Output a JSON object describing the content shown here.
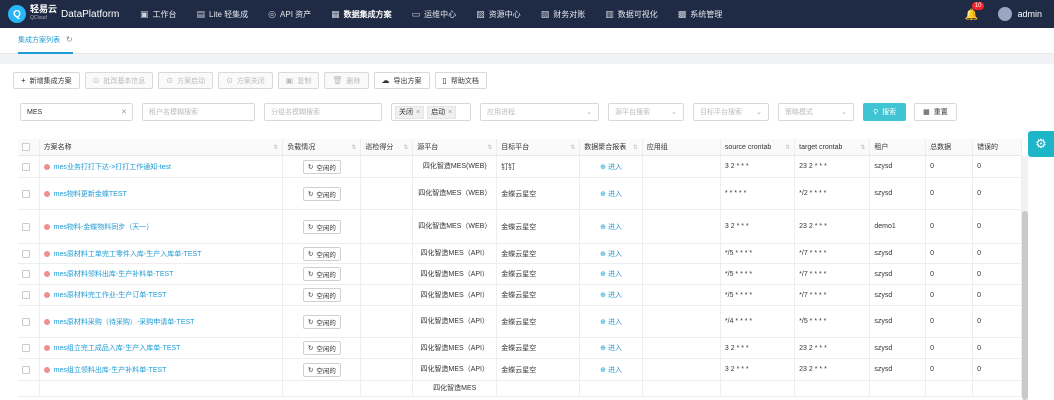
{
  "app": {
    "logo_cn": "轻易云",
    "logo_en": "QCloud",
    "platform": "DataPlatform"
  },
  "nav": [
    {
      "icon": "desktop-icon",
      "glyph": "▣",
      "label": "工作台"
    },
    {
      "icon": "layers-icon",
      "glyph": "▤",
      "label": "Lite 轻集成"
    },
    {
      "icon": "api-icon",
      "glyph": "◎",
      "label": "API 资产"
    },
    {
      "icon": "integration-icon",
      "glyph": "▦",
      "label": "数据集成方案",
      "active": true
    },
    {
      "icon": "ops-icon",
      "glyph": "▭",
      "label": "运维中心"
    },
    {
      "icon": "resource-icon",
      "glyph": "▨",
      "label": "资源中心"
    },
    {
      "icon": "finance-icon",
      "glyph": "▧",
      "label": "财务对账"
    },
    {
      "icon": "chart-icon",
      "glyph": "▥",
      "label": "数据可视化"
    },
    {
      "icon": "settings-icon",
      "glyph": "▩",
      "label": "系统管理"
    }
  ],
  "header": {
    "notification_count": "10",
    "username": "admin"
  },
  "tab": {
    "label": "集成方案列表"
  },
  "toolbar": {
    "add": "新增集成方案",
    "batch_edit": "批改基本信息",
    "start": "方案启动",
    "stop": "方案关闭",
    "copy": "复制",
    "delete": "删除",
    "export": "导出方案",
    "help": "帮助文档"
  },
  "filters": {
    "keyword_value": "MES",
    "tenant_placeholder": "租户名模糊搜索",
    "platform_placeholder": "分组名模糊搜索",
    "status_chips": [
      "关闭",
      "启动"
    ],
    "process_placeholder": "应用进程",
    "source_placeholder": "源平台搜索",
    "target_placeholder": "目标平台搜索",
    "strategy_placeholder": "策略模式",
    "search_label": "搜索",
    "reset_label": "重置"
  },
  "table": {
    "headers": [
      "方案名称",
      "负载情况",
      "巡检得分",
      "源平台",
      "目标平台",
      "数据聚合报表",
      "应用组",
      "source crontab",
      "target crontab",
      "租户",
      "总数据",
      "错误的"
    ],
    "enter_label": "进入",
    "rows": [
      {
        "name": "mes业务打打下达->打打工作通知-test",
        "status": "空闲的",
        "score": "",
        "source": "四化智造MES(WEB)",
        "target": "钉钉",
        "app_group": "",
        "source_cron": "3 2 * * *",
        "target_cron": "23 2 * * *",
        "tenant": "szysd",
        "total": "0",
        "errors": "0"
      },
      {
        "name": "mes物料更新金蝶TEST",
        "status": "空闲的",
        "score": "",
        "source": "四化智造MES（WEB）",
        "target": "金蝶云星空",
        "app_group": "",
        "source_cron": "* * * * *",
        "target_cron": "*/2 * * * *",
        "tenant": "szysd",
        "total": "0",
        "errors": "0"
      },
      {
        "name": "mes物料-金蝶物料同步（天一）",
        "status": "空闲的",
        "score": "",
        "source": "四化智造MES（WEB）",
        "target": "金蝶云星空",
        "app_group": "",
        "source_cron": "3 2 * * *",
        "target_cron": "23 2 * * *",
        "tenant": "demo1",
        "total": "0",
        "errors": "0"
      },
      {
        "name": "mes原材料工单完工零件入库-生产入库单-TEST",
        "status": "空闲的",
        "score": "",
        "source": "四化智造MES（API）",
        "target": "金蝶云星空",
        "app_group": "",
        "source_cron": "*/5 * * * *",
        "target_cron": "*/7 * * * *",
        "tenant": "szysd",
        "total": "0",
        "errors": "0"
      },
      {
        "name": "mes原材料领料出库-生产补料单-TEST",
        "status": "空闲的",
        "score": "",
        "source": "四化智造MES（API）",
        "target": "金蝶云星空",
        "app_group": "",
        "source_cron": "*/5 * * * *",
        "target_cron": "*/7 * * * *",
        "tenant": "szysd",
        "total": "0",
        "errors": "0"
      },
      {
        "name": "mes原材料完工作业-生产订单-TEST",
        "status": "空闲的",
        "score": "",
        "source": "四化智造MES（API）",
        "target": "金蝶云星空",
        "app_group": "",
        "source_cron": "*/5 * * * *",
        "target_cron": "*/7 * * * *",
        "tenant": "szysd",
        "total": "0",
        "errors": "0"
      },
      {
        "name": "mes原材料采购（待采购）-采购申请单-TEST",
        "status": "空闲的",
        "score": "",
        "source": "四化智造MES（API）",
        "target": "金蝶云星空",
        "app_group": "",
        "source_cron": "*/4 * * * *",
        "target_cron": "*/5 * * * *",
        "tenant": "szysd",
        "total": "0",
        "errors": "0"
      },
      {
        "name": "mes组立完工成品入库-生产入库单-TEST",
        "status": "空闲的",
        "score": "",
        "source": "四化智造MES（API）",
        "target": "金蝶云星空",
        "app_group": "",
        "source_cron": "3 2 * * *",
        "target_cron": "23 2 * * *",
        "tenant": "szysd",
        "total": "0",
        "errors": "0"
      },
      {
        "name": "mes组立领料出库-生产补料单-TEST",
        "status": "空闲的",
        "score": "",
        "source": "四化智造MES（API）",
        "target": "金蝶云星空",
        "app_group": "",
        "source_cron": "3 2 * * *",
        "target_cron": "23 2 * * *",
        "tenant": "szysd",
        "total": "0",
        "errors": "0"
      },
      {
        "name": "",
        "status": "",
        "score": "",
        "source": "四化智造MES",
        "target": "",
        "app_group": "",
        "source_cron": "",
        "target_cron": "",
        "tenant": "",
        "total": "",
        "errors": ""
      }
    ]
  },
  "colors": {
    "topbar": "#1f2a44",
    "accent": "#1c9bd5",
    "primary_button": "#40c4d4"
  }
}
